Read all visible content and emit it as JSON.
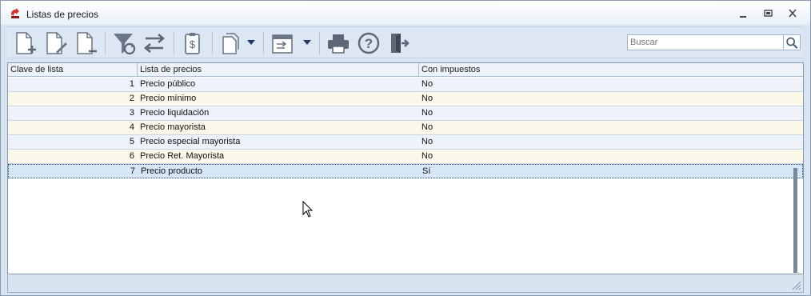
{
  "window": {
    "title": "Listas de precios"
  },
  "toolbar": {
    "buttons": [
      {
        "name": "new-document-icon"
      },
      {
        "name": "edit-document-icon"
      },
      {
        "name": "delete-document-icon"
      },
      {
        "name": "filter-refresh-icon"
      },
      {
        "name": "swap-arrows-icon"
      },
      {
        "name": "price-list-icon"
      },
      {
        "name": "copy-document-icon"
      },
      {
        "name": "export-window-icon"
      },
      {
        "name": "print-icon"
      },
      {
        "name": "help-icon"
      },
      {
        "name": "exit-icon"
      }
    ],
    "search_placeholder": "Buscar"
  },
  "grid": {
    "columns": [
      "Clave de lista",
      "Lista de precios",
      "Con impuestos"
    ],
    "rows": [
      {
        "key": "1",
        "name": "Precio público",
        "tax": "No"
      },
      {
        "key": "2",
        "name": "Precio mínimo",
        "tax": "No"
      },
      {
        "key": "3",
        "name": "Precio liquidación",
        "tax": "No"
      },
      {
        "key": "4",
        "name": "Precio mayorista",
        "tax": "No"
      },
      {
        "key": "5",
        "name": "Precio especial mayorista",
        "tax": "No"
      },
      {
        "key": "6",
        "name": "Precio Ret. Mayorista",
        "tax": "No"
      },
      {
        "key": "7",
        "name": "Precio producto",
        "tax": "Sí"
      }
    ],
    "selected_row": 7
  },
  "colors": {
    "title_bg": "#eaf0f8",
    "toolbar_bg": "#dde7f3",
    "row_even": "#eef3fb",
    "row_odd": "#fbf8ea",
    "row_selected": "#d7e6f7"
  }
}
